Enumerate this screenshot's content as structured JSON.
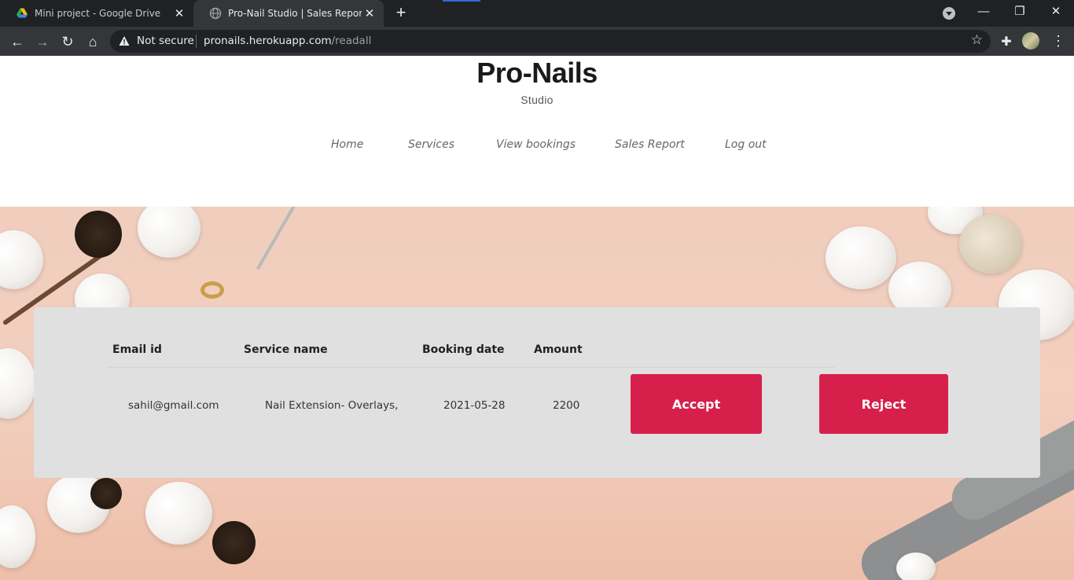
{
  "browser": {
    "tabs": [
      {
        "title": "Mini project - Google Drive",
        "active": false,
        "icon": "google-drive-icon"
      },
      {
        "title": "Pro-Nail Studio | Sales Report",
        "active": true,
        "icon": "globe-icon"
      }
    ],
    "new_tab_label": "+",
    "security_label": "Not secure",
    "url_host": "pronails.herokuapp.com",
    "url_path": "/readall"
  },
  "site": {
    "title": "Pro-Nails",
    "subtitle": "Studio",
    "nav": [
      "Home",
      "Services",
      "View bookings",
      "Sales Report",
      "Log out"
    ]
  },
  "table": {
    "headers": [
      "Email id",
      "Service name",
      "Booking date",
      "Amount"
    ],
    "rows": [
      {
        "email": "sahil@gmail.com",
        "service": "Nail Extension- Overlays,",
        "date": "2021-05-28",
        "amount": "2200"
      }
    ],
    "accept_label": "Accept",
    "reject_label": "Reject"
  },
  "colors": {
    "accent": "#d6204b",
    "panel": "#e0e0e0",
    "hero_bg": "#f0cdbd"
  }
}
